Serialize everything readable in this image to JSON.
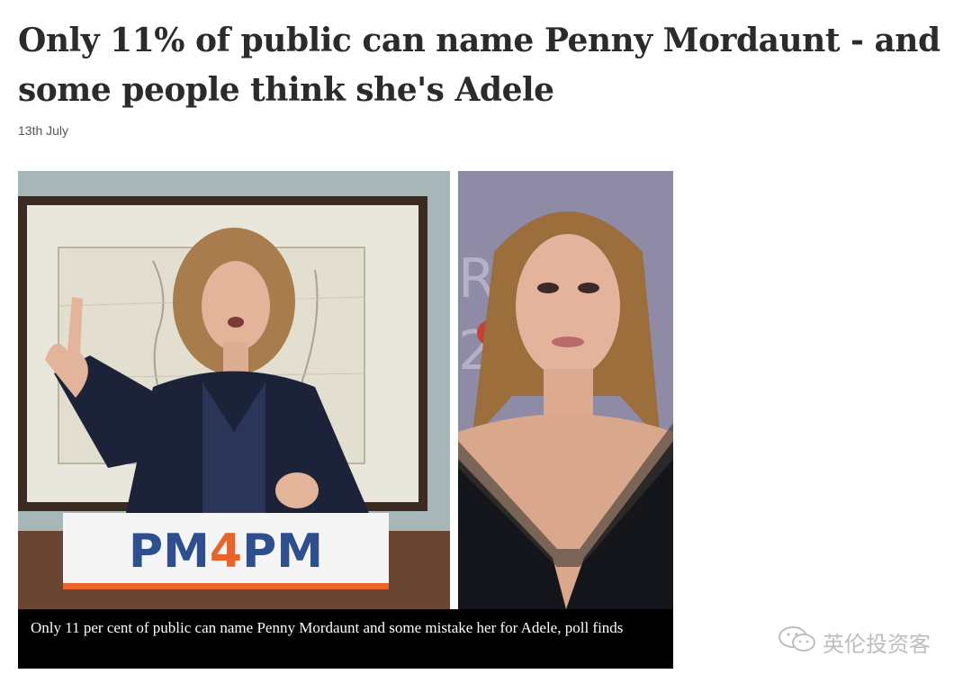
{
  "article": {
    "headline": "Only 11% of public can name Penny Mordaunt - and some people think she's Adele",
    "date": "13th July",
    "caption": "Only 11 per cent of public can name Penny Mordaunt and some mistake her for Adele, poll finds"
  },
  "photo_left": {
    "podium_sign": {
      "part1": "PM",
      "part2": "4",
      "part3": "PM"
    }
  },
  "watermark": {
    "text": "英伦投资客",
    "icon": "wechat-icon"
  },
  "colors": {
    "headline": "#2b2b2b",
    "caption_bg": "#000000",
    "sign_blue": "#2d4e8f",
    "sign_orange": "#e8642a"
  }
}
